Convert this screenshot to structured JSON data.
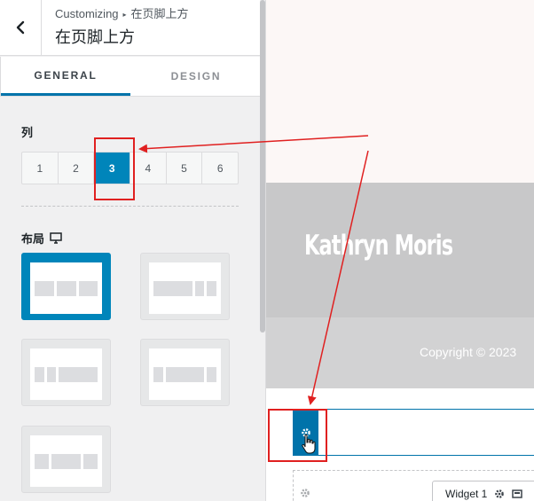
{
  "header": {
    "breadcrumb_root": "Customizing",
    "breadcrumb_sep": "▸",
    "breadcrumb_current": "在页脚上方",
    "section_title": "在页脚上方"
  },
  "tabs": {
    "general": "GENERAL",
    "design": "DESIGN"
  },
  "columns": {
    "label": "列",
    "options": [
      "1",
      "2",
      "3",
      "4",
      "5",
      "6"
    ],
    "selected": "3"
  },
  "layout": {
    "label": "布局",
    "device_icon": "desktop-icon",
    "selected_index": 0
  },
  "preview": {
    "site_name": "Kathryn Moris",
    "copyright": "Copyright © 2023",
    "widget_label": "Widget 1"
  },
  "colors": {
    "accent": "#0085ba",
    "annotation_red": "#e02020"
  }
}
